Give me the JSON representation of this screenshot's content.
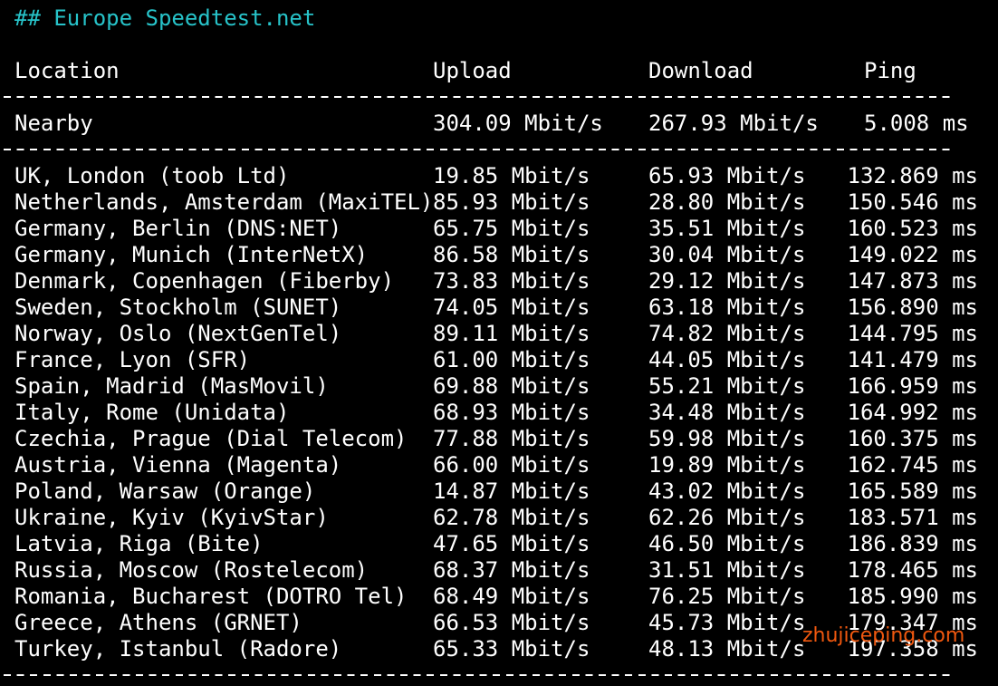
{
  "terminal": {
    "heading": "## Europe Speedtest.net",
    "columns": {
      "location": "Location",
      "upload": "Upload",
      "download": "Download",
      "ping": "Ping"
    },
    "nearby": {
      "location": "Nearby",
      "upload": "304.09 Mbit/s",
      "download": "267.93 Mbit/s",
      "ping": "5.008 ms"
    },
    "rows": [
      {
        "location": "UK, London (toob Ltd)",
        "upload": "19.85 Mbit/s",
        "download": "65.93 Mbit/s",
        "ping": "132.869 ms"
      },
      {
        "location": "Netherlands, Amsterdam (MaxiTEL)",
        "upload": "85.93 Mbit/s",
        "download": "28.80 Mbit/s",
        "ping": "150.546 ms"
      },
      {
        "location": "Germany, Berlin (DNS:NET)",
        "upload": "65.75 Mbit/s",
        "download": "35.51 Mbit/s",
        "ping": "160.523 ms"
      },
      {
        "location": "Germany, Munich (InterNetX)",
        "upload": "86.58 Mbit/s",
        "download": "30.04 Mbit/s",
        "ping": "149.022 ms"
      },
      {
        "location": "Denmark, Copenhagen (Fiberby)",
        "upload": "73.83 Mbit/s",
        "download": "29.12 Mbit/s",
        "ping": "147.873 ms"
      },
      {
        "location": "Sweden, Stockholm (SUNET)",
        "upload": "74.05 Mbit/s",
        "download": "63.18 Mbit/s",
        "ping": "156.890 ms"
      },
      {
        "location": "Norway, Oslo (NextGenTel)",
        "upload": "89.11 Mbit/s",
        "download": "74.82 Mbit/s",
        "ping": "144.795 ms"
      },
      {
        "location": "France, Lyon (SFR)",
        "upload": "61.00 Mbit/s",
        "download": "44.05 Mbit/s",
        "ping": "141.479 ms"
      },
      {
        "location": "Spain, Madrid (MasMovil)",
        "upload": "69.88 Mbit/s",
        "download": "55.21 Mbit/s",
        "ping": "166.959 ms"
      },
      {
        "location": "Italy, Rome (Unidata)",
        "upload": "68.93 Mbit/s",
        "download": "34.48 Mbit/s",
        "ping": "164.992 ms"
      },
      {
        "location": "Czechia, Prague (Dial Telecom)",
        "upload": "77.88 Mbit/s",
        "download": "59.98 Mbit/s",
        "ping": "160.375 ms"
      },
      {
        "location": "Austria, Vienna (Magenta)",
        "upload": "66.00 Mbit/s",
        "download": "19.89 Mbit/s",
        "ping": "162.745 ms"
      },
      {
        "location": "Poland, Warsaw (Orange)",
        "upload": "14.87 Mbit/s",
        "download": "43.02 Mbit/s",
        "ping": "165.589 ms"
      },
      {
        "location": "Ukraine, Kyiv (KyivStar)",
        "upload": "62.78 Mbit/s",
        "download": "62.26 Mbit/s",
        "ping": "183.571 ms"
      },
      {
        "location": "Latvia, Riga (Bite)",
        "upload": "47.65 Mbit/s",
        "download": "46.50 Mbit/s",
        "ping": "186.839 ms"
      },
      {
        "location": "Russia, Moscow (Rostelecom)",
        "upload": "68.37 Mbit/s",
        "download": "31.51 Mbit/s",
        "ping": "178.465 ms"
      },
      {
        "location": "Romania, Bucharest (DOTRO Tel)",
        "upload": "68.49 Mbit/s",
        "download": "76.25 Mbit/s",
        "ping": "185.990 ms"
      },
      {
        "location": "Greece, Athens (GRNET)",
        "upload": "66.53 Mbit/s",
        "download": "45.73 Mbit/s",
        "ping": "179.347 ms"
      },
      {
        "location": "Turkey, Istanbul (Radore)",
        "upload": "65.33 Mbit/s",
        "download": "48.13 Mbit/s",
        "ping": "197.358 ms"
      }
    ]
  },
  "watermark": "zhujiceping.com",
  "colors": {
    "background": "#000000",
    "text": "#ffffff",
    "heading": "#27c3c9",
    "watermark": "#f0580f"
  }
}
